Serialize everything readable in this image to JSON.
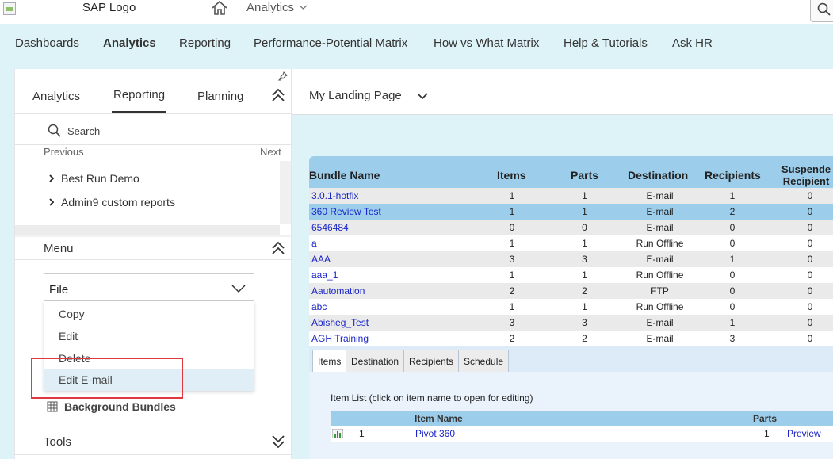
{
  "header": {
    "logo_text": "SAP Logo",
    "app_title": "Analytics"
  },
  "nav": {
    "items": [
      "Dashboards",
      "Analytics",
      "Reporting",
      "Performance-Potential Matrix",
      "How vs What Matrix",
      "Help & Tutorials",
      "Ask HR"
    ],
    "active": "Analytics"
  },
  "left_panel": {
    "tabs": [
      "Analytics",
      "Reporting",
      "Planning"
    ],
    "active_tab": "Reporting",
    "search_label": "Search",
    "prev_label": "Previous",
    "next_label": "Next",
    "tree_items": [
      "Best Run Demo",
      "Admin9 custom reports"
    ],
    "menu_title": "Menu",
    "file_select_value": "File",
    "dropdown_items": [
      "Copy",
      "Edit",
      "Delete",
      "Edit E-mail"
    ],
    "dropdown_hover": "Edit E-mail",
    "background_bundles": "Background Bundles",
    "tools_title": "Tools"
  },
  "right_panel": {
    "landing_title": "My Landing Page"
  },
  "bundle_table": {
    "columns": [
      "Bundle Name",
      "Items",
      "Parts",
      "Destination",
      "Recipients",
      "Suspended Recipients"
    ],
    "suspended_header_line1": "Suspende",
    "suspended_header_line2": "Recipient",
    "rows": [
      {
        "name": "3.0.1-hotfix",
        "items": "1",
        "parts": "1",
        "destination": "E-mail",
        "recipients": "1",
        "suspended": "0"
      },
      {
        "name": "360 Review Test",
        "items": "1",
        "parts": "1",
        "destination": "E-mail",
        "recipients": "2",
        "suspended": "0"
      },
      {
        "name": "6546484",
        "items": "0",
        "parts": "0",
        "destination": "E-mail",
        "recipients": "0",
        "suspended": "0"
      },
      {
        "name": "a",
        "items": "1",
        "parts": "1",
        "destination": "Run Offline",
        "recipients": "0",
        "suspended": "0"
      },
      {
        "name": "AAA",
        "items": "3",
        "parts": "3",
        "destination": "E-mail",
        "recipients": "1",
        "suspended": "0"
      },
      {
        "name": "aaa_1",
        "items": "1",
        "parts": "1",
        "destination": "Run Offline",
        "recipients": "0",
        "suspended": "0"
      },
      {
        "name": "Aautomation",
        "items": "2",
        "parts": "2",
        "destination": "FTP",
        "recipients": "0",
        "suspended": "0"
      },
      {
        "name": "abc",
        "items": "1",
        "parts": "1",
        "destination": "Run Offline",
        "recipients": "0",
        "suspended": "0"
      },
      {
        "name": "Abisheg_Test",
        "items": "3",
        "parts": "3",
        "destination": "E-mail",
        "recipients": "1",
        "suspended": "0"
      },
      {
        "name": "AGH Training",
        "items": "2",
        "parts": "2",
        "destination": "E-mail",
        "recipients": "3",
        "suspended": "0"
      }
    ],
    "selected_row": 1
  },
  "bundle_tabs": {
    "tabs": [
      "Items",
      "Destination",
      "Recipients",
      "Schedule"
    ],
    "active": "Items"
  },
  "item_list": {
    "label": "Item List (click on item name to open for editing)",
    "col_item_name": "Item Name",
    "col_parts": "Parts",
    "rows": [
      {
        "index": "1",
        "name": "Pivot 360",
        "parts": "1",
        "action": "Preview"
      }
    ]
  },
  "colors": {
    "nav_bg": "#def3f7",
    "table_header": "#9ccdeb",
    "link": "#1a25c8",
    "highlight_box": "#e0383e"
  }
}
